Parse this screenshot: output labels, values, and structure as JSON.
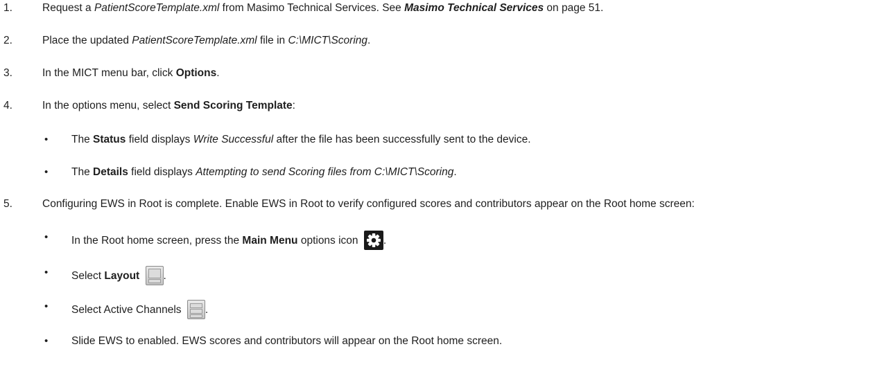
{
  "steps": [
    {
      "num": "1.",
      "segments": [
        {
          "t": "Request a ",
          "s": "plain"
        },
        {
          "t": "PatientScoreTemplate.xml",
          "s": "italic"
        },
        {
          "t": " from Masimo Technical Services. See ",
          "s": "plain"
        },
        {
          "t": "Masimo Technical Services",
          "s": "bolditalic"
        },
        {
          "t": " on page 51.",
          "s": "plain"
        }
      ]
    },
    {
      "num": "2.",
      "segments": [
        {
          "t": "Place the updated ",
          "s": "plain"
        },
        {
          "t": "PatientScoreTemplate.xml",
          "s": "italic"
        },
        {
          "t": " file in ",
          "s": "plain"
        },
        {
          "t": "C:\\MICT\\Scoring",
          "s": "italic"
        },
        {
          "t": ".",
          "s": "plain"
        }
      ]
    },
    {
      "num": "3.",
      "segments": [
        {
          "t": "In the MICT menu bar, click ",
          "s": "plain"
        },
        {
          "t": "Options",
          "s": "bold"
        },
        {
          "t": ".",
          "s": "plain"
        }
      ]
    },
    {
      "num": "4.",
      "segments": [
        {
          "t": "In the options menu, select ",
          "s": "plain"
        },
        {
          "t": "Send Scoring Template",
          "s": "bold"
        },
        {
          "t": ":",
          "s": "plain"
        }
      ]
    },
    {
      "num": "5.",
      "segments": [
        {
          "t": "Configuring EWS in Root is complete. Enable EWS in Root to verify configured scores and contributors appear on the Root home screen:",
          "s": "plain"
        }
      ]
    }
  ],
  "bullets_step4": [
    [
      {
        "t": "The ",
        "s": "plain"
      },
      {
        "t": "Status",
        "s": "bold"
      },
      {
        "t": " field displays ",
        "s": "plain"
      },
      {
        "t": "Write Successful",
        "s": "italic"
      },
      {
        "t": " after the file has been successfully sent to the device.",
        "s": "plain"
      }
    ],
    [
      {
        "t": "The ",
        "s": "plain"
      },
      {
        "t": "Details",
        "s": "bold"
      },
      {
        "t": " field displays ",
        "s": "plain"
      },
      {
        "t": "Attempting to send Scoring files from C:\\MICT\\Scoring",
        "s": "italic"
      },
      {
        "t": ".",
        "s": "plain"
      }
    ]
  ],
  "bullets_step5": [
    {
      "segments": [
        {
          "t": "In the Root home screen, press the ",
          "s": "plain"
        },
        {
          "t": "Main Menu",
          "s": "bold"
        },
        {
          "t": " options icon ",
          "s": "plain"
        }
      ],
      "icon": "gear-icon",
      "after": "."
    },
    {
      "segments": [
        {
          "t": "Select ",
          "s": "plain"
        },
        {
          "t": "Layout",
          "s": "bold"
        },
        {
          "t": " ",
          "s": "plain"
        }
      ],
      "icon": "layout-icon",
      "after": "."
    },
    {
      "segments": [
        {
          "t": "Select Active Channels ",
          "s": "plain"
        }
      ],
      "icon": "active-channels-icon",
      "after": "."
    },
    {
      "segments": [
        {
          "t": "Slide EWS to enabled. EWS scores and contributors will appear on the Root home screen.",
          "s": "plain"
        }
      ],
      "icon": null,
      "after": ""
    }
  ],
  "bullet_glyph": "•"
}
